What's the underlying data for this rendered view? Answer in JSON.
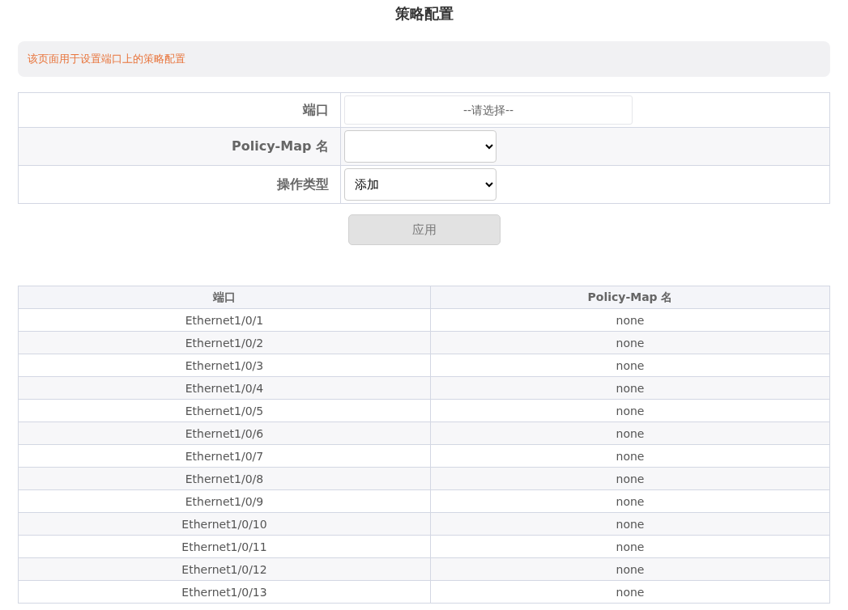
{
  "title": "策略配置",
  "notice": "该页面用于设置端口上的策略配置",
  "form": {
    "port": {
      "label": "端口",
      "placeholder": "--请选择--"
    },
    "policy_map": {
      "label": "Policy-Map 名"
    },
    "operation": {
      "label": "操作类型",
      "value": "添加"
    }
  },
  "apply_button": {
    "label": "应用",
    "disabled": true
  },
  "table": {
    "columns": [
      "端口",
      "Policy-Map 名"
    ],
    "rows": [
      [
        "Ethernet1/0/1",
        "none"
      ],
      [
        "Ethernet1/0/2",
        "none"
      ],
      [
        "Ethernet1/0/3",
        "none"
      ],
      [
        "Ethernet1/0/4",
        "none"
      ],
      [
        "Ethernet1/0/5",
        "none"
      ],
      [
        "Ethernet1/0/6",
        "none"
      ],
      [
        "Ethernet1/0/7",
        "none"
      ],
      [
        "Ethernet1/0/8",
        "none"
      ],
      [
        "Ethernet1/0/9",
        "none"
      ],
      [
        "Ethernet1/0/10",
        "none"
      ],
      [
        "Ethernet1/0/11",
        "none"
      ],
      [
        "Ethernet1/0/12",
        "none"
      ],
      [
        "Ethernet1/0/13",
        "none"
      ]
    ]
  }
}
